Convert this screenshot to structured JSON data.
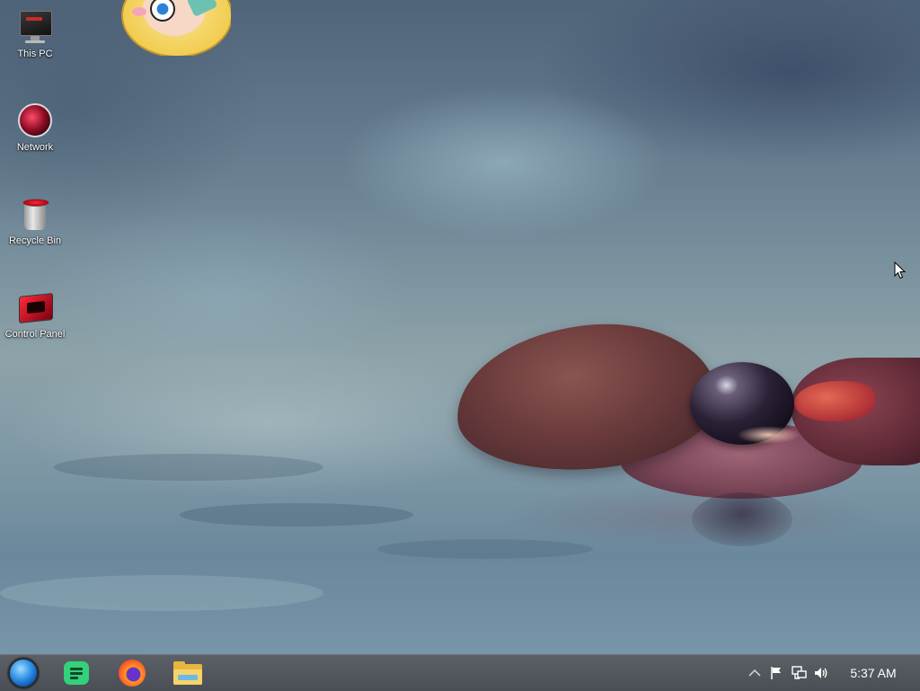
{
  "desktop": {
    "icons": [
      {
        "label": "This PC"
      },
      {
        "label": "Network"
      },
      {
        "label": "Recycle Bin"
      },
      {
        "label": "Control Panel"
      }
    ]
  },
  "taskbar": {
    "pinned": [
      {
        "icon": "start-orb-icon"
      },
      {
        "icon": "notes-icon"
      },
      {
        "icon": "firefox-icon"
      },
      {
        "icon": "file-explorer-icon"
      }
    ],
    "tray": {
      "icons": [
        "chevron-up-icon",
        "flag-icon",
        "network-icon",
        "volume-icon"
      ],
      "clock": "5:37 AM"
    }
  },
  "colors": {
    "taskbar": "#4f545a",
    "accent": "#2f8fe6"
  }
}
